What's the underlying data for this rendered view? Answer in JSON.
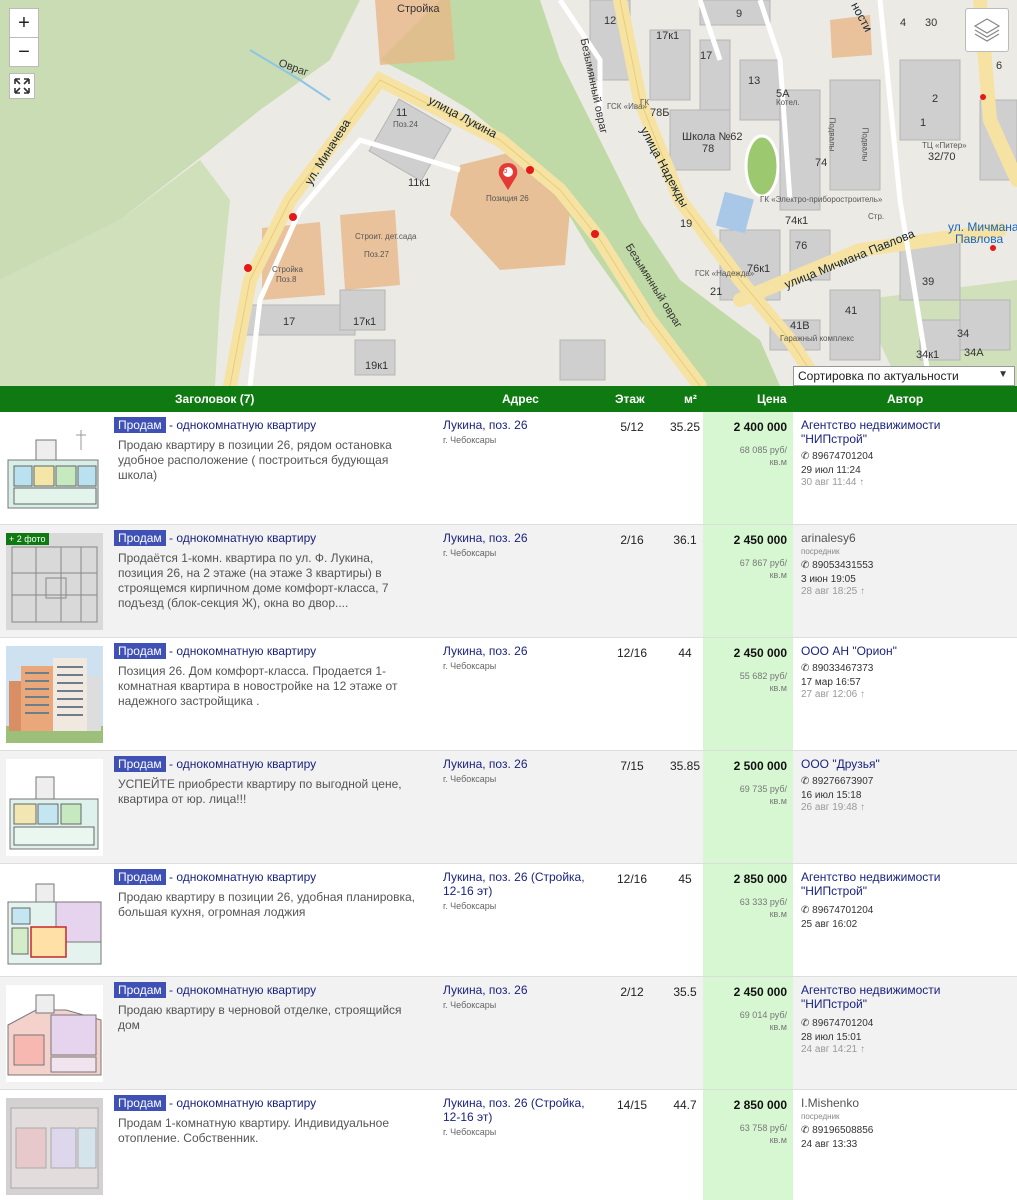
{
  "map": {
    "zoom_in": "+",
    "zoom_out": "−",
    "fullscreen_icon": "fullscreen-icon",
    "layers_icon": "layers-icon",
    "labels": {
      "ovrag": "Овраг",
      "stroyka_top": "Стройка",
      "n11": "11",
      "poz24": "Поз.24",
      "n11k1": "11к1",
      "ul_minacheva": "ул. Миначева",
      "ulitsa_lukina": "улица Лукина",
      "pozitsiya26": "Позиция 26",
      "pin_number": "6",
      "stroit_det_sada": "Строит. дет.сада",
      "poz27": "Поз.27",
      "stroyka_poz8": "Стройка",
      "poz8": "Поз.8",
      "n17": "17",
      "n17k1": "17к1",
      "n19k1": "19к1",
      "bezym_ovrag_1": "Безымянный овраг",
      "bezym_ovrag_2": "Безымянный овраг",
      "n17k1_top": "17к1",
      "n17_b": "17",
      "n13": "13",
      "gsk_iva": "ГСК «Ива»",
      "gk": "ГК",
      "n78b": "78Б",
      "shkola62": "Школа №62",
      "n78": "78",
      "ulitsa_nadezhdy": "улица Надежды",
      "n19": "19",
      "gsk_nadezhda": "ГСК «Надежда»",
      "n21": "21",
      "n76": "76",
      "n76k1": "76к1",
      "n74": "74",
      "n74k1": "74к1",
      "str": "Стр.",
      "podvaly_1": "Подвалы",
      "podvaly_2": "Подвалы",
      "n9": "9",
      "n5a": "5А",
      "kotel": "Котел.",
      "n4": "4",
      "n30": "30",
      "n6": "6",
      "n2": "2",
      "n1": "1",
      "tts_piter": "ТЦ «Питер»",
      "n32_70": "32/70",
      "ulitsa_michmana_pavlova": "улица Мичмана Павлова",
      "ul_michmana": "ул. Мичмана",
      "pavlova": "Павлова",
      "n39": "39",
      "n41": "41",
      "n41v": "41В",
      "garazhny": "Гаражный комплекс",
      "n34": "34",
      "n34k1": "34к1",
      "n34a": "34А",
      "nosti": "ности",
      "gk_elektro": "ГК «Электро-приборостроитель»",
      "n12": "12"
    },
    "sort_label": "Сортировка по актуальности"
  },
  "header": {
    "title": "Заголовок (7)",
    "address": "Адрес",
    "floor": "Этаж",
    "area": "м²",
    "price": "Цена",
    "author": "Автор"
  },
  "listings": [
    {
      "type": "Продам",
      "kind": "- однокомнатную квартиру",
      "desc": "Продаю квартиру в позиции 26, рядом остановка удобное расположение ( построиться будующая школа)",
      "addr": "Лукина, поз. 26",
      "city": "г. Чебоксары",
      "floor": "5/12",
      "area": "35.25",
      "price": "2 400 000",
      "ppm": "68 085 руб/",
      "ppm_unit": "кв.м",
      "author": "Агентство недвижимости \"НИПстрой\"",
      "role": "",
      "phone": "89674701204",
      "date1": "29 июл 11:24",
      "date2": "30 авг 11:44 ↑"
    },
    {
      "type": "Продам",
      "kind": "- однокомнатную квартиру",
      "desc": "Продаётся 1-комн. квартира по ул. Ф. Лукина, позиция 26, на 2 этаже (на этаже 3 квартиры) в строящемся кирпичном доме комфорт-класса, 7 подъезд (блок-секция Ж), окна во двор....",
      "addr": "Лукина, поз. 26",
      "city": "г. Чебоксары",
      "floor": "2/16",
      "area": "36.1",
      "price": "2 450 000",
      "ppm": "67 867 руб/",
      "ppm_unit": "кв.м",
      "author": "arinalesy6",
      "role": "посредник",
      "phone": "89053431553",
      "date1": "3 июн 19:05",
      "date2": "28 авг 18:25 ↑",
      "badge": "+ 2 фото"
    },
    {
      "type": "Продам",
      "kind": "- однокомнатную квартиру",
      "desc": "Позиция 26. Дом комфорт-класса. Продается 1-комнатная квартира в новостройке на 12 этаже от надежного застройщика .",
      "addr": "Лукина, поз. 26",
      "city": "г. Чебоксары",
      "floor": "12/16",
      "area": "44",
      "price": "2 450 000",
      "ppm": "55 682 руб/",
      "ppm_unit": "кв.м",
      "author": "ООО АН \"Орион\"",
      "role": "",
      "phone": "89033467373",
      "date1": "17 мар 16:57",
      "date2": "27 авг 12:06 ↑"
    },
    {
      "type": "Продам",
      "kind": "- однокомнатную квартиру",
      "desc": "УСПЕЙТЕ приобрести квартиру по выгодной цене, квартира от юр. лица!!!",
      "addr": "Лукина, поз. 26",
      "city": "г. Чебоксары",
      "floor": "7/15",
      "area": "35.85",
      "price": "2 500 000",
      "ppm": "69 735 руб/",
      "ppm_unit": "кв.м",
      "author": "ООО \"Друзья\"",
      "role": "",
      "phone": "89276673907",
      "date1": "16 июл 15:18",
      "date2": "26 авг 19:48 ↑"
    },
    {
      "type": "Продам",
      "kind": "- однокомнатную квартиру",
      "desc": "Продаю квартиру в позиции 26, удобная планировка, большая кухня, огромная лоджия",
      "addr": "Лукина, поз. 26 (Стройка, 12-16 эт)",
      "city": "г. Чебоксары",
      "floor": "12/16",
      "area": "45",
      "price": "2 850 000",
      "ppm": "63 333 руб/",
      "ppm_unit": "кв.м",
      "author": "Агентство недвижимости \"НИПстрой\"",
      "role": "",
      "phone": "89674701204",
      "date1": "25 авг 16:02",
      "date2": ""
    },
    {
      "type": "Продам",
      "kind": "- однокомнатную квартиру",
      "desc": "Продаю квартиру в черновой отделке, строящийся дом",
      "addr": "Лукина, поз. 26",
      "city": "г. Чебоксары",
      "floor": "2/12",
      "area": "35.5",
      "price": "2 450 000",
      "ppm": "69 014 руб/",
      "ppm_unit": "кв.м",
      "author": "Агентство недвижимости \"НИПстрой\"",
      "role": "",
      "phone": "89674701204",
      "date1": "28 июл 15:01",
      "date2": "24 авг 14:21 ↑"
    },
    {
      "type": "Продам",
      "kind": "- однокомнатную квартиру",
      "desc": "Продам 1-комнатную квартиру. Индивидуальное отопление. Собственник.",
      "addr": "Лукина, поз. 26 (Стройка, 12-16 эт)",
      "city": "г. Чебоксары",
      "floor": "14/15",
      "area": "44.7",
      "price": "2 850 000",
      "ppm": "63 758 руб/",
      "ppm_unit": "кв.м",
      "author": "I.Mishenko",
      "role": "посредник",
      "phone": "89196508856",
      "date1": "24 авг 13:33",
      "date2": ""
    }
  ]
}
